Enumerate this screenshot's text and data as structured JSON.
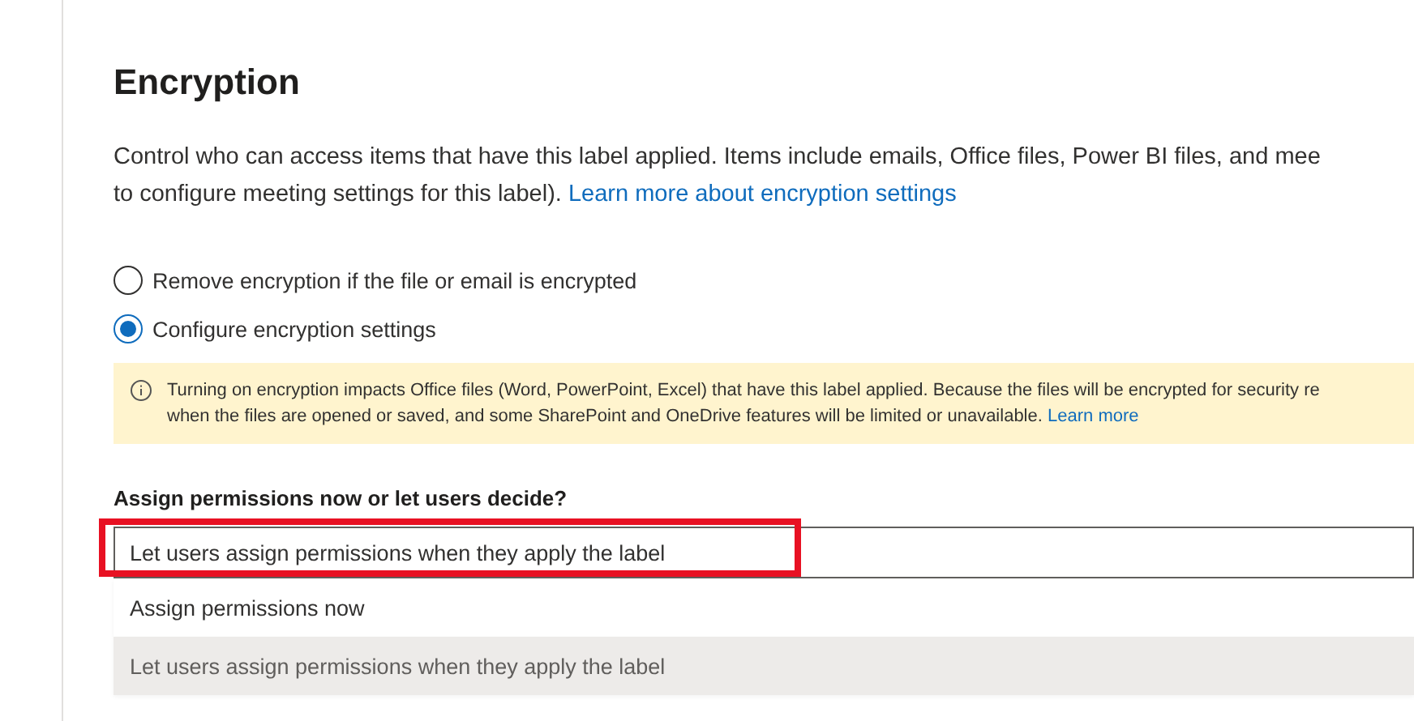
{
  "heading": "Encryption",
  "description": {
    "text": "Control who can access items that have this label applied. Items include emails, Office files, Power BI files, and mee",
    "text_2": "to configure meeting settings for this label).",
    "link": "Learn more about encryption settings"
  },
  "radios": [
    {
      "label": "Remove encryption if the file or email is encrypted",
      "selected": false
    },
    {
      "label": "Configure encryption settings",
      "selected": true
    }
  ],
  "notice": {
    "line_1": "Turning on encryption impacts Office files (Word, PowerPoint, Excel) that have this label applied. Because the files will be encrypted for security re",
    "line_2": "when the files are opened or saved, and some SharePoint and OneDrive features will be limited or unavailable.",
    "link": "Learn more"
  },
  "permissions": {
    "label": "Assign permissions now or let users decide?",
    "value": "Let users assign permissions when they apply the label",
    "highlighted": true,
    "options": [
      {
        "label": "Assign permissions now",
        "selected": false
      },
      {
        "label": "Let users assign permissions when they apply the label",
        "selected": true
      }
    ]
  }
}
